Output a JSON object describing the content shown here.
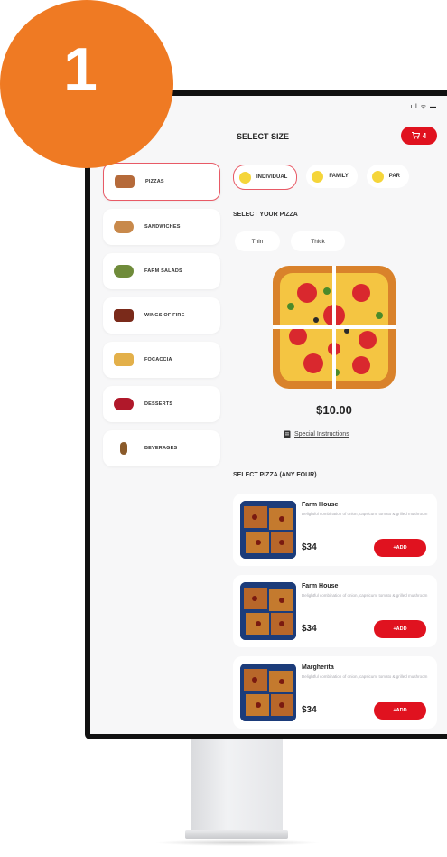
{
  "badge": {
    "number": "1",
    "color": "#ef7a23"
  },
  "status": {
    "icons": "ıll ᯤ ▬"
  },
  "header": {
    "title": "SELECT SIZE",
    "cart_count": "4",
    "cart_icon": "cart-icon"
  },
  "sidebar": {
    "items": [
      {
        "label": "PIZZAS",
        "active": true,
        "color": "#b56a3a"
      },
      {
        "label": "SANDWICHES",
        "active": false,
        "color": "#c8894b"
      },
      {
        "label": "FARM SALADS",
        "active": false,
        "color": "#6f8b3a"
      },
      {
        "label": "WINGS OF FIRE",
        "active": false,
        "color": "#7a2a1a"
      },
      {
        "label": "FOCACCIA",
        "active": false,
        "color": "#e3b04a"
      },
      {
        "label": "DESSERTS",
        "active": false,
        "color": "#b0182a"
      },
      {
        "label": "BEVERAGES",
        "active": false,
        "color": "#8a5a2a"
      }
    ]
  },
  "sizes": [
    {
      "label": "INDIVIDUAL",
      "active": true
    },
    {
      "label": "FAMILY",
      "active": false
    },
    {
      "label": "PAR",
      "active": false
    }
  ],
  "select_pizza": {
    "title": "SELECT YOUR PIZZA",
    "crusts": [
      "Thin",
      "Thick"
    ]
  },
  "product": {
    "price": "$10.00",
    "instructions": "Special Instructions"
  },
  "list": {
    "title": "SELECT PIZZA (ANY FOUR)",
    "items": [
      {
        "name": "Farm House",
        "desc": "Delightful combination of onion, capsicum, tomato & grilled mushroom",
        "price": "$34",
        "add": "+ADD"
      },
      {
        "name": "Farm House",
        "desc": "Delightful combination of onion, capsicum, tomato & grilled mushroom",
        "price": "$34",
        "add": "+ADD"
      },
      {
        "name": "Margherita",
        "desc": "Delightful combination of onion, capsicum, tomato & grilled mushroom",
        "price": "$34",
        "add": "+ADD"
      }
    ]
  },
  "accent": "#e0121f"
}
